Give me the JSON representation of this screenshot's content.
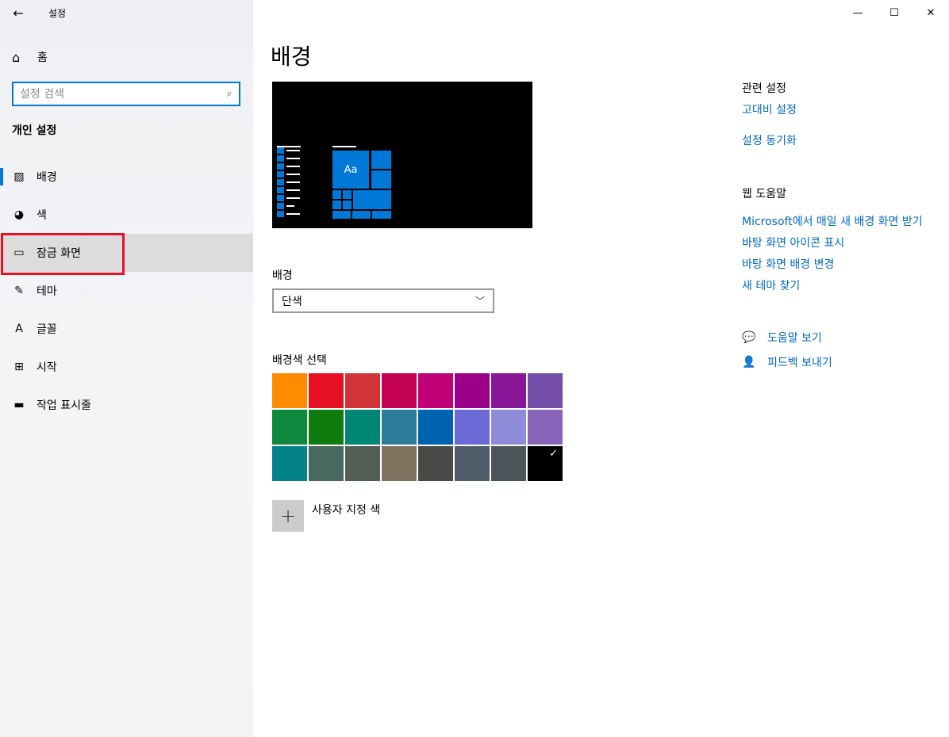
{
  "window": {
    "title": "설정",
    "back_icon": "back-arrow-icon",
    "controls": {
      "minimize": "—",
      "maximize": "☐",
      "close": "✕"
    }
  },
  "sidebar": {
    "home_label": "홈",
    "search_placeholder": "설정 검색",
    "section_title": "개인 설정",
    "items": [
      {
        "label": "배경",
        "icon": "picture-icon"
      },
      {
        "label": "색",
        "icon": "palette-icon"
      },
      {
        "label": "잠금 화면",
        "icon": "lock-screen-icon"
      },
      {
        "label": "테마",
        "icon": "theme-brush-icon"
      },
      {
        "label": "글꼴",
        "icon": "font-icon"
      },
      {
        "label": "시작",
        "icon": "start-icon"
      },
      {
        "label": "작업 표시줄",
        "icon": "taskbar-icon"
      }
    ]
  },
  "main": {
    "page_title": "배경",
    "preview_sample_text": "Aa",
    "background_label": "배경",
    "background_value": "단색",
    "color_section_label": "배경색 선택",
    "colors": [
      "#ff8c00",
      "#e81123",
      "#d13438",
      "#c30052",
      "#bf0077",
      "#9a0089",
      "#881798",
      "#744da9",
      "#10893e",
      "#107c10",
      "#018574",
      "#2d7d9a",
      "#0063b1",
      "#6b69d6",
      "#8e8cd8",
      "#8764b8",
      "#038387",
      "#486860",
      "#525e54",
      "#7e735f",
      "#4c4a48",
      "#515c6b",
      "#4a5459",
      "#000000"
    ],
    "selected_color_index": 23,
    "custom_color_label": "사용자 지정 색"
  },
  "right": {
    "related_heading": "관련 설정",
    "related_links": [
      "고대비 설정",
      "설정 동기화"
    ],
    "web_help_heading": "웹 도움말",
    "web_links": [
      "Microsoft에서 매일 새 배경 화면 받기",
      "바탕 화면 아이콘 표시",
      "바탕 화면 배경 변경",
      "새 테마 찾기"
    ],
    "help_label": "도움말 보기",
    "feedback_label": "피드백 보내기"
  },
  "accent_color": "#0078d7",
  "highlight_color": "#e81123"
}
